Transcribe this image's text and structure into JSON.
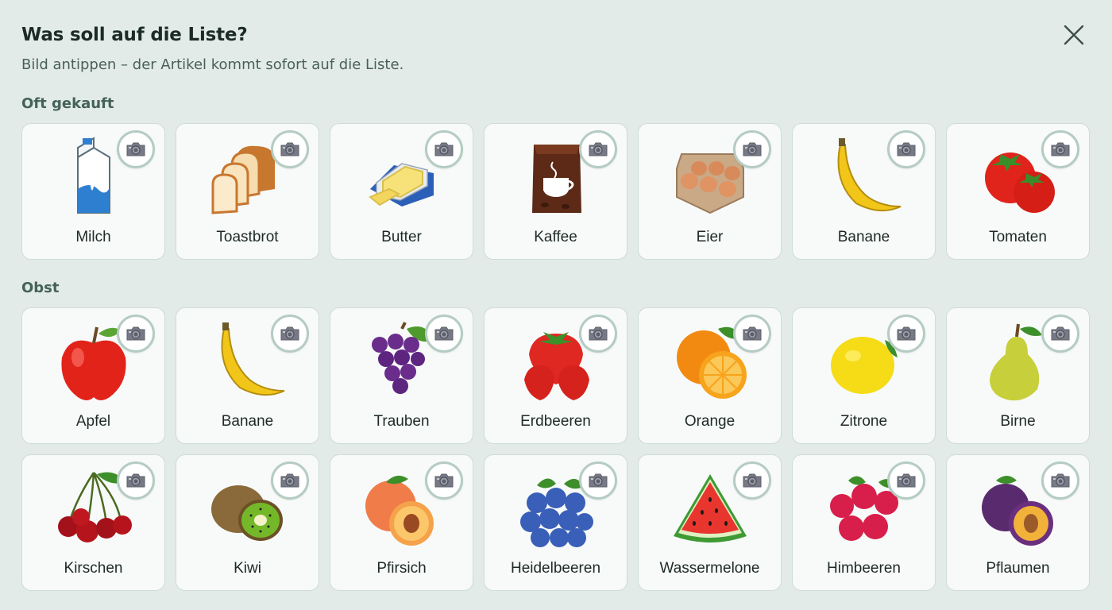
{
  "header": {
    "title": "Was soll auf die Liste?",
    "subtitle": "Bild antippen – der Artikel kommt sofort auf die Liste."
  },
  "sections": [
    {
      "heading": "Oft gekauft",
      "items": [
        {
          "label": "Milch",
          "icon": "milk-carton-icon"
        },
        {
          "label": "Toastbrot",
          "icon": "toast-bread-icon"
        },
        {
          "label": "Butter",
          "icon": "butter-icon"
        },
        {
          "label": "Kaffee",
          "icon": "coffee-bag-icon"
        },
        {
          "label": "Eier",
          "icon": "egg-carton-icon"
        },
        {
          "label": "Banane",
          "icon": "banana-icon"
        },
        {
          "label": "Tomaten",
          "icon": "tomato-icon"
        }
      ]
    },
    {
      "heading": "Obst",
      "items": [
        {
          "label": "Apfel",
          "icon": "apple-icon"
        },
        {
          "label": "Banane",
          "icon": "banana-icon"
        },
        {
          "label": "Trauben",
          "icon": "grapes-icon"
        },
        {
          "label": "Erdbeeren",
          "icon": "strawberry-icon"
        },
        {
          "label": "Orange",
          "icon": "orange-icon"
        },
        {
          "label": "Zitrone",
          "icon": "lemon-icon"
        },
        {
          "label": "Birne",
          "icon": "pear-icon"
        },
        {
          "label": "Kirschen",
          "icon": "cherries-icon"
        },
        {
          "label": "Kiwi",
          "icon": "kiwi-icon"
        },
        {
          "label": "Pfirsich",
          "icon": "peach-icon"
        },
        {
          "label": "Heidelbeeren",
          "icon": "blueberries-icon"
        },
        {
          "label": "Wassermelone",
          "icon": "watermelon-icon"
        },
        {
          "label": "Himbeeren",
          "icon": "raspberries-icon"
        },
        {
          "label": "Pflaumen",
          "icon": "plums-icon"
        }
      ]
    }
  ],
  "colors": {
    "background": "#e2ebe7",
    "card": "#f7faf9",
    "camera_ring": "#b5ccc3",
    "heading": "#45625a"
  }
}
